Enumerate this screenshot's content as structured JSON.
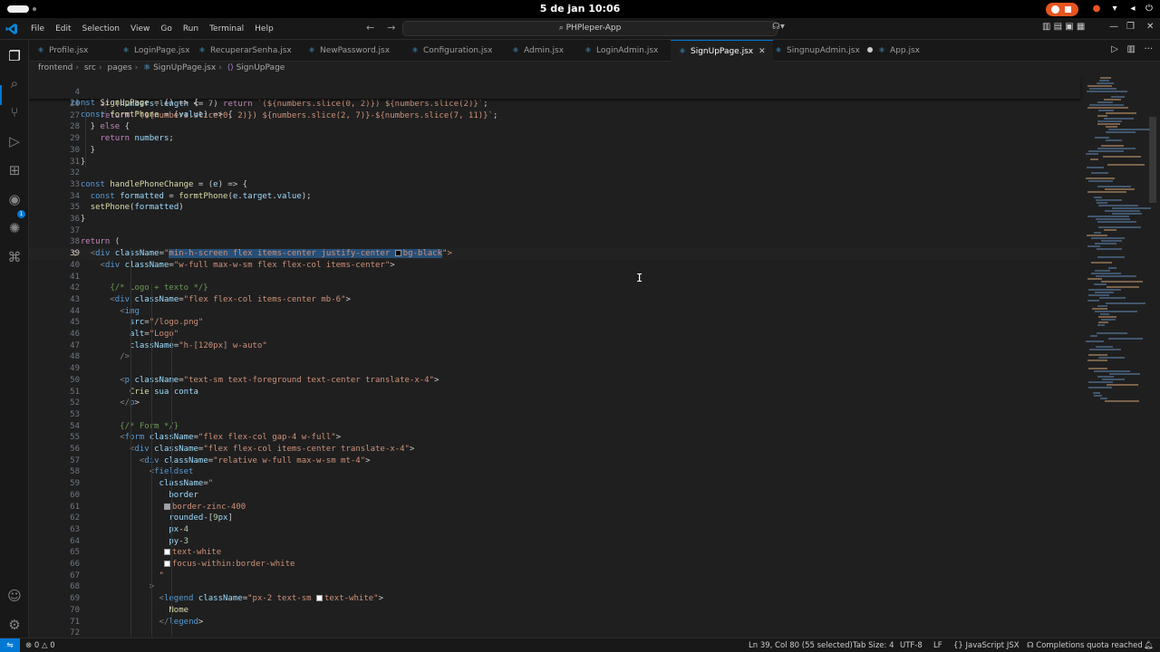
{
  "system_bar": {
    "clock": "5 de jan  10:06"
  },
  "titlebar": {
    "menu": [
      "File",
      "Edit",
      "Selection",
      "View",
      "Go",
      "Run",
      "Terminal",
      "Help"
    ],
    "search_text": "PHPleper-App"
  },
  "tabs": [
    {
      "label": "Profile.jsx",
      "active": false
    },
    {
      "label": "LoginPage.jsx",
      "active": false
    },
    {
      "label": "RecuperarSenha.jsx",
      "active": false
    },
    {
      "label": "NewPassword.jsx",
      "active": false
    },
    {
      "label": "Configuration.jsx",
      "active": false
    },
    {
      "label": "Admin.jsx",
      "active": false
    },
    {
      "label": "LoginAdmin.jsx",
      "active": false
    },
    {
      "label": "SignUpPage.jsx",
      "active": true
    },
    {
      "label": "SingnupAdmin.jsx",
      "active": false,
      "modified": true
    },
    {
      "label": "App.jsx",
      "active": false
    }
  ],
  "breadcrumb": [
    "frontend",
    "src",
    "pages",
    "SignUpPage.jsx",
    "SignUpPage"
  ],
  "sticky_lines": [
    {
      "ln": "4",
      "text": "const SignUpPage = () => {"
    },
    {
      "ln": "21",
      "text": "  const formtPhone = (value) => {"
    }
  ],
  "code_lines": [
    {
      "ln": "26",
      "text": "      if (numbers.length <= 7) return `(${numbers.slice(0, 2)}) ${numbers.slice(2)}`;"
    },
    {
      "ln": "27",
      "text": "      return `(${numbers.slice(0, 2)}) ${numbers.slice(2, 7)}-${numbers.slice(7, 11)}`;"
    },
    {
      "ln": "28",
      "text": "    } else {"
    },
    {
      "ln": "29",
      "text": "      return numbers;"
    },
    {
      "ln": "30",
      "text": "    }"
    },
    {
      "ln": "31",
      "text": "  }"
    },
    {
      "ln": "32",
      "text": ""
    },
    {
      "ln": "33",
      "text": "  const handlePhoneChange = (e) => {"
    },
    {
      "ln": "34",
      "text": "    const formatted = formtPhone(e.target.value);"
    },
    {
      "ln": "35",
      "text": "    setPhone(formatted)"
    },
    {
      "ln": "36",
      "text": "  }"
    },
    {
      "ln": "37",
      "text": ""
    },
    {
      "ln": "38",
      "text": "  return ("
    },
    {
      "ln": "39",
      "text": "    <div className=\"min-h-screen flex items-center justify-center bg-black\">"
    },
    {
      "ln": "40",
      "text": "      <div className=\"w-full max-w-sm flex flex-col items-center\">"
    },
    {
      "ln": "41",
      "text": ""
    },
    {
      "ln": "42",
      "text": "        {/* Logo + texto */}"
    },
    {
      "ln": "43",
      "text": "        <div className=\"flex flex-col items-center mb-6\">"
    },
    {
      "ln": "44",
      "text": "          <img"
    },
    {
      "ln": "45",
      "text": "            src=\"/logo.png\""
    },
    {
      "ln": "46",
      "text": "            alt=\"Logo\""
    },
    {
      "ln": "47",
      "text": "            className=\"h-[120px] w-auto\""
    },
    {
      "ln": "48",
      "text": "          />"
    },
    {
      "ln": "49",
      "text": ""
    },
    {
      "ln": "50",
      "text": "          <p className=\"text-sm text-foreground text-center translate-x-4\">"
    },
    {
      "ln": "51",
      "text": "            Crie sua conta"
    },
    {
      "ln": "52",
      "text": "          </p>"
    },
    {
      "ln": "53",
      "text": ""
    },
    {
      "ln": "54",
      "text": "          {/* Form */}"
    },
    {
      "ln": "55",
      "text": "          <form className=\"flex flex-col gap-4 w-full\">"
    },
    {
      "ln": "56",
      "text": "            <div className=\"flex flex-col items-center translate-x-4\">"
    },
    {
      "ln": "57",
      "text": "              <div className=\"relative w-full max-w-sm mt-4\">"
    },
    {
      "ln": "58",
      "text": "                <fieldset"
    },
    {
      "ln": "59",
      "text": "                  className=\""
    },
    {
      "ln": "60",
      "text": "                    border"
    },
    {
      "ln": "61",
      "text": "                    border-zinc-400"
    },
    {
      "ln": "62",
      "text": "                    rounded-[9px]"
    },
    {
      "ln": "63",
      "text": "                    px-4"
    },
    {
      "ln": "64",
      "text": "                    py-3"
    },
    {
      "ln": "65",
      "text": "                    text-white"
    },
    {
      "ln": "66",
      "text": "                    focus-within:border-white"
    },
    {
      "ln": "67",
      "text": "                  \""
    },
    {
      "ln": "68",
      "text": "                >"
    },
    {
      "ln": "69",
      "text": "                  <legend className=\"px-2 text-sm text-white\">"
    },
    {
      "ln": "70",
      "text": "                    Nome"
    },
    {
      "ln": "71",
      "text": "                  </legend>"
    },
    {
      "ln": "72",
      "text": ""
    }
  ],
  "statusbar": {
    "errors": "0",
    "warnings": "0",
    "position": "Ln 39, Col 80 (55 selected)",
    "tab_size": "Tab Size: 4",
    "encoding": "UTF-8",
    "eol": "LF",
    "language": "JavaScript JSX",
    "copilot": "Completions quota reached"
  },
  "colors": {
    "accent": "#0078d4",
    "recording": "#e95420",
    "selection": "#264f78"
  },
  "icons": [
    "explorer-icon",
    "search-icon",
    "source-control-icon",
    "run-debug-icon",
    "extensions-icon",
    "remote-icon",
    "copilot-icon",
    "docker-icon",
    "account-icon",
    "settings-gear-icon"
  ]
}
